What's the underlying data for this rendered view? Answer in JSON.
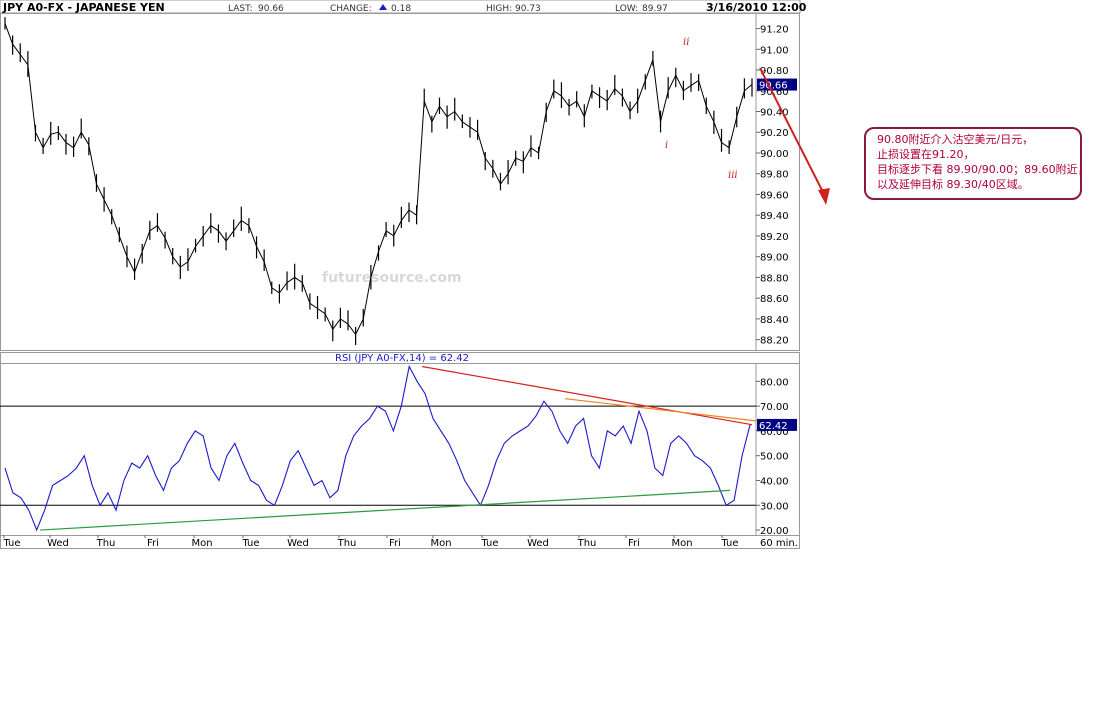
{
  "header": {
    "symbol": "JPY A0-FX - JAPANESE YEN",
    "last_label": "LAST:",
    "last_value": "90.66",
    "change_label": "CHANGE:",
    "change_value": "0.18",
    "high_label": "HIGH:",
    "high_value": "90.73",
    "low_label": "LOW:",
    "low_value": "89.97",
    "datetime": "3/16/2010 12:00"
  },
  "price_axis": {
    "ticks": [
      "91.20",
      "91.00",
      "90.80",
      "90.60",
      "90.40",
      "90.20",
      "90.00",
      "89.80",
      "89.60",
      "89.40",
      "89.20",
      "89.00",
      "88.80",
      "88.60",
      "88.40",
      "88.20"
    ],
    "last_tag": "90.66"
  },
  "rsi_panel": {
    "title": "RSI (JPY A0-FX,14) = 62.42",
    "ticks": [
      "80.00",
      "70.00",
      "60.00",
      "50.00",
      "40.00",
      "30.00",
      "20.00"
    ],
    "last_tag": "62.42"
  },
  "x_labels": [
    "Tue",
    "Wed",
    "Thu",
    "Fri",
    "Mon",
    "Tue",
    "Wed",
    "Thu",
    "Fri",
    "Mon",
    "Tue",
    "Wed",
    "Thu",
    "Fri",
    "Mon",
    "Tue"
  ],
  "timeframe": "60 min.",
  "watermark": "futuresource.com",
  "wave_labels": {
    "i": "i",
    "ii": "ii",
    "iii": "iii"
  },
  "annotation": {
    "lines": [
      "90.80附近介入沽空美元/日元，",
      "止损设置在91.20，",
      "目标逐步下看 89.90/90.00；89.60附近，",
      "以及延伸目标 89.30/40区域。"
    ]
  },
  "colors": {
    "price": "#000000",
    "rsi": "#1a1acd",
    "resistance": "#d82020",
    "support": "#2a9a3a",
    "orange_trend": "#f08020",
    "tag_bg": "#000080",
    "annotation_border": "#8b1a3a"
  },
  "chart_data": [
    {
      "type": "line",
      "title": "JPY A0-FX - JAPANESE YEN",
      "timeframe": "60 min.",
      "ylim": [
        88.1,
        91.35
      ],
      "x_categories": [
        "Tue",
        "Wed",
        "Thu",
        "Fri",
        "Mon",
        "Tue",
        "Wed",
        "Thu",
        "Fri",
        "Mon",
        "Tue",
        "Wed",
        "Thu",
        "Fri",
        "Mon",
        "Tue"
      ],
      "series": [
        {
          "values": [
            91.25,
            91.05,
            90.95,
            90.85,
            90.2,
            90.05,
            90.18,
            90.2,
            90.1,
            90.05,
            90.2,
            90.08,
            89.7,
            89.55,
            89.4,
            89.2,
            89.0,
            88.85,
            89.05,
            89.25,
            89.3,
            89.18,
            89.0,
            88.9,
            88.95,
            89.1,
            89.2,
            89.3,
            89.25,
            89.15,
            89.25,
            89.35,
            89.3,
            89.1,
            88.95,
            88.7,
            88.65,
            88.75,
            88.8,
            88.75,
            88.55,
            88.5,
            88.45,
            88.3,
            88.4,
            88.35,
            88.25,
            88.4,
            88.8,
            89.05,
            89.25,
            89.2,
            89.35,
            89.45,
            89.4,
            90.5,
            90.3,
            90.45,
            90.35,
            90.4,
            90.3,
            90.25,
            90.2,
            89.95,
            89.85,
            89.7,
            89.8,
            89.95,
            89.92,
            90.05,
            90.0,
            90.4,
            90.6,
            90.55,
            90.45,
            90.5,
            90.35,
            90.6,
            90.55,
            90.5,
            90.62,
            90.55,
            90.4,
            90.5,
            90.7,
            90.9,
            90.3,
            90.6,
            90.75,
            90.6,
            90.65,
            90.7,
            90.45,
            90.3,
            90.1,
            90.05,
            90.35,
            90.6,
            90.66
          ]
        }
      ],
      "annotations": [
        "i",
        "ii",
        "iii"
      ]
    },
    {
      "type": "line",
      "title": "RSI (JPY A0-FX,14) = 62.42",
      "ylim": [
        18,
        87
      ],
      "reference_lines": [
        70,
        30
      ],
      "series": [
        {
          "values": [
            45,
            35,
            33,
            28,
            20,
            28,
            38,
            40,
            42,
            45,
            50,
            38,
            30,
            35,
            28,
            40,
            47,
            45,
            50,
            42,
            36,
            45,
            48,
            55,
            60,
            58,
            45,
            40,
            50,
            55,
            47,
            40,
            38,
            32,
            30,
            38,
            48,
            52,
            45,
            38,
            40,
            33,
            36,
            50,
            58,
            62,
            65,
            70,
            68,
            60,
            70,
            86,
            80,
            75,
            65,
            60,
            55,
            48,
            40,
            35,
            30,
            38,
            48,
            55,
            58,
            60,
            62,
            66,
            72,
            68,
            60,
            55,
            62,
            65,
            50,
            45,
            60,
            58,
            62,
            55,
            68,
            60,
            45,
            42,
            55,
            58,
            55,
            50,
            48,
            45,
            38,
            30,
            32,
            50,
            62.42
          ]
        }
      ]
    }
  ]
}
